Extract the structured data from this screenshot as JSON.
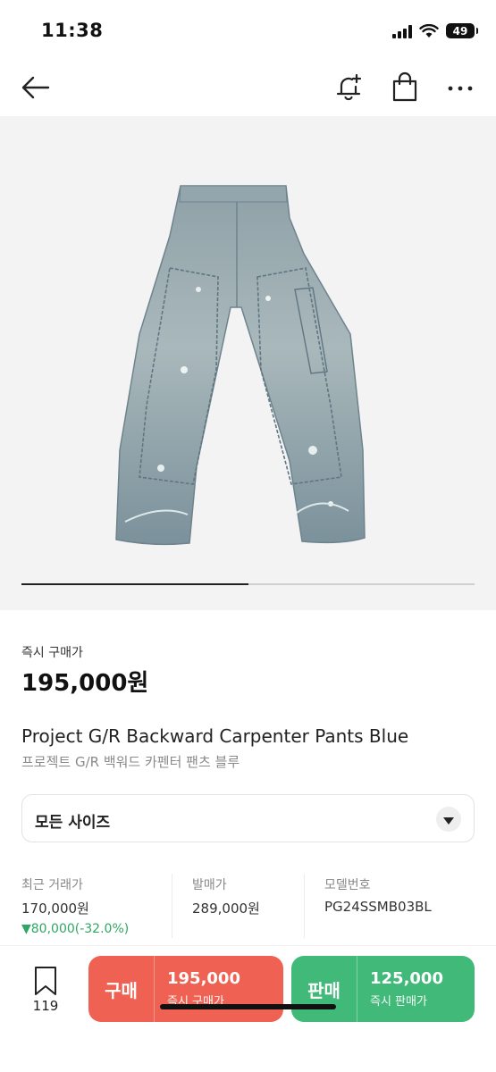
{
  "status_bar": {
    "time": "11:38",
    "battery": "49",
    "icons": [
      "signal-icon",
      "wifi-icon",
      "battery-icon"
    ]
  },
  "nav": {
    "icons": [
      "back-arrow-icon",
      "bell-plus-icon",
      "shopping-bag-icon",
      "more-icon"
    ]
  },
  "product_image": {
    "image_progress": 0.5
  },
  "price": {
    "label": "즉시 구매가",
    "value": "195,000원"
  },
  "product": {
    "title_en": "Project G/R Backward Carpenter Pants Blue",
    "title_ko": "프로젝트 G/R 백워드 카펜터 팬츠 블루"
  },
  "size_select": {
    "label": "모든 사이즈"
  },
  "info": {
    "recent": {
      "label": "최근 거래가",
      "value": "170,000원",
      "change": "▼80,000(-32.0%)"
    },
    "release": {
      "label": "발매가",
      "value": "289,000원"
    },
    "model": {
      "label": "모델번호",
      "value": "PG24SSMB03BL"
    }
  },
  "bottom": {
    "wishlist_count": "119",
    "buy": {
      "type": "구매",
      "price": "195,000",
      "sub": "즉시 구매가"
    },
    "sell": {
      "type": "판매",
      "price": "125,000",
      "sub": "즉시 판매가"
    }
  },
  "colors": {
    "buy": "#ef6253",
    "sell": "#41b979",
    "change_down": "#2fa764",
    "image_bg": "#f3f3f3"
  }
}
